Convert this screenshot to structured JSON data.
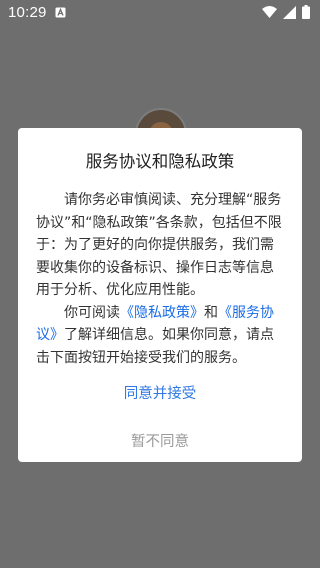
{
  "status_bar": {
    "time": "10:29",
    "icons": [
      "notification-a-icon",
      "wifi-icon",
      "signal-icon",
      "battery-icon"
    ]
  },
  "dialog": {
    "title": "服务协议和隐私政策",
    "paragraph1": "请你务必审慎阅读、充分理解“服务协议”和“隐私政策”各条款，包括但不限于：为了更好的向你提供服务，我们需要收集你的设备标识、操作日志等信息用于分析、优化应用性能。",
    "paragraph2": {
      "prefix": "你可阅读",
      "privacy_link": "《隐私政策》",
      "middle": "和",
      "service_link": "《服务协议》",
      "suffix": "了解详细信息。如果你同意，请点击下面按钮开始接受我们的服务。"
    },
    "agree_label": "同意并接受",
    "disagree_label": "暂不同意"
  },
  "colors": {
    "overlay": "#6e6e6e",
    "link": "#1a6ce8",
    "agree": "#2d78e6",
    "disagree": "#9a9a9a"
  }
}
